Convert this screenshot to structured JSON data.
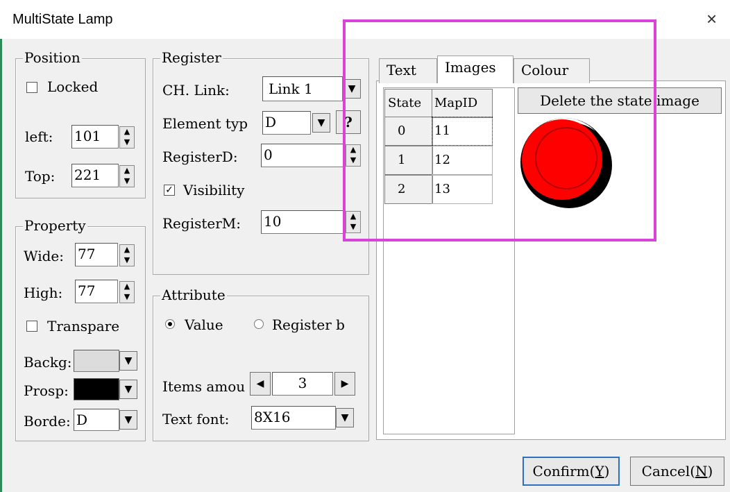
{
  "window": {
    "title": "MultiState Lamp",
    "close_label": "×"
  },
  "position": {
    "label": "Position",
    "locked_label": "Locked",
    "locked_checked": false,
    "left_label": "left:",
    "left_value": "101",
    "top_label": "Top:",
    "top_value": "221"
  },
  "property": {
    "label": "Property",
    "wide_label": "Wide:",
    "wide_value": "77",
    "high_label": "High:",
    "high_value": "77",
    "transparent_label": "Transpare",
    "transparent_checked": false,
    "background_label": "Backg:",
    "background_color": "#dcdcdc",
    "prospect_label": "Prosp:",
    "prospect_color": "#000000",
    "border_label": "Borde:",
    "border_value": "D"
  },
  "register": {
    "label": "Register",
    "ch_link_label": "CH. Link:",
    "ch_link_value": "Link 1",
    "element_type_label": "Element typ",
    "element_type_value": "D",
    "help_label": "?",
    "register_d_label": "RegisterD:",
    "register_d_value": "0",
    "visibility_label": "Visibility",
    "visibility_checked": true,
    "register_m_label": "RegisterM:",
    "register_m_value": "10"
  },
  "attribute": {
    "label": "Attribute",
    "value_label": "Value",
    "register_b_label": "Register b",
    "selected": "Value",
    "items_amount_label": "Items amou",
    "items_amount_value": "3",
    "text_font_label": "Text font:",
    "text_font_value": "8X16"
  },
  "tabs": [
    {
      "label": "Text",
      "active": false
    },
    {
      "label": "Images",
      "active": true
    },
    {
      "label": "Colour",
      "active": false
    }
  ],
  "state_table": {
    "headers": [
      "State",
      "MapID"
    ],
    "rows": [
      [
        "0",
        "11"
      ],
      [
        "1",
        "12"
      ],
      [
        "2",
        "13"
      ]
    ]
  },
  "delete_image_label": "Delete the state image",
  "lamp": {
    "icon": "red-lamp-icon",
    "color": "#ff0000"
  },
  "buttons": {
    "confirm_label": "Confirm(",
    "confirm_key": "Y",
    "cancel_label": "Cancel(",
    "cancel_key": "N",
    "close_paren": ")"
  },
  "highlight_color": "#d943d9"
}
